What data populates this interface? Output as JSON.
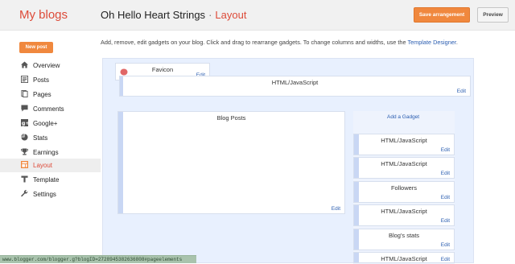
{
  "header": {
    "brand": "My blogs",
    "blog_name": "Oh Hello Heart Strings",
    "separator": "·",
    "page_name": "Layout",
    "save_label": "Save arrangement",
    "preview_label": "Preview"
  },
  "sidebar": {
    "new_post_label": "New post",
    "items": [
      {
        "label": "Overview",
        "icon": "home-icon"
      },
      {
        "label": "Posts",
        "icon": "posts-icon"
      },
      {
        "label": "Pages",
        "icon": "pages-icon"
      },
      {
        "label": "Comments",
        "icon": "comments-icon"
      },
      {
        "label": "Google+",
        "icon": "google-plus-icon"
      },
      {
        "label": "Stats",
        "icon": "stats-icon"
      },
      {
        "label": "Earnings",
        "icon": "trophy-icon"
      },
      {
        "label": "Layout",
        "icon": "layout-icon",
        "active": true
      },
      {
        "label": "Template",
        "icon": "template-icon"
      },
      {
        "label": "Settings",
        "icon": "wrench-icon"
      }
    ],
    "accent_color": "#dd4b39"
  },
  "main": {
    "hint_text": "Add, remove, edit gadgets on your blog. Click and drag to rearrange gadgets. To change columns and widths, use the ",
    "hint_link": "Template Designer",
    "hint_end": ".",
    "favicon": {
      "title": "Favicon",
      "edit": "Edit"
    },
    "header_gadget": {
      "title": "HTML/JavaScript",
      "edit": "Edit"
    },
    "blog_posts": {
      "title": "Blog Posts",
      "edit": "Edit"
    },
    "add_gadget_label": "Add a Gadget",
    "sidebar_gadgets": [
      {
        "title": "HTML/JavaScript",
        "edit": "Edit"
      },
      {
        "title": "HTML/JavaScript",
        "edit": "Edit"
      },
      {
        "title": "Followers",
        "edit": "Edit"
      },
      {
        "title": "HTML/JavaScript",
        "edit": "Edit"
      },
      {
        "title": "Blog's stats",
        "edit": "Edit"
      },
      {
        "title": "HTML/JavaScript",
        "edit": "Edit"
      }
    ]
  },
  "statusbar": {
    "url": "www.blogger.com/blogger.g?blogID=2728945382636808#pageelements"
  }
}
